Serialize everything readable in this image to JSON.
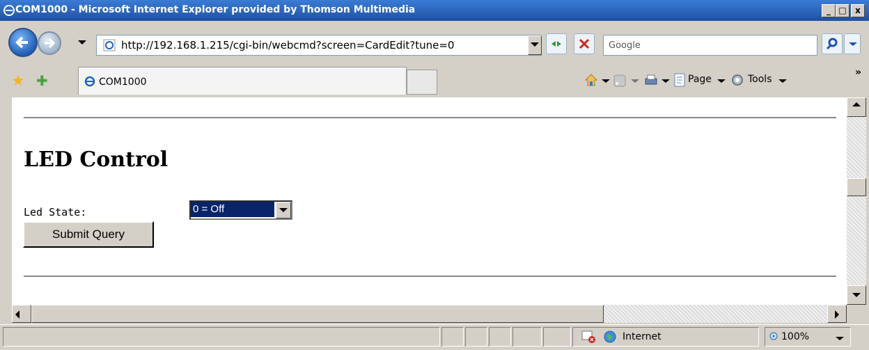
{
  "window": {
    "title": "COM1000 - Microsoft Internet Explorer provided by Thomson Multimedia",
    "min_label": "_",
    "max_label": "□",
    "close_label": "x"
  },
  "toolbar": {
    "address": "http://192.168.1.215/cgi-bin/webcmd?screen=CardEdit?tune=0",
    "search_placeholder": "Google"
  },
  "tab": {
    "label": "COM1000"
  },
  "commandbar": {
    "page_label": "Page",
    "tools_label": "Tools",
    "more": "»"
  },
  "page": {
    "heading": "LED Control",
    "led_label": "Led State:",
    "led_selected": "0 = Off",
    "submit_label": "Submit Query"
  },
  "status": {
    "zone": "Internet",
    "zoom": "100%"
  }
}
